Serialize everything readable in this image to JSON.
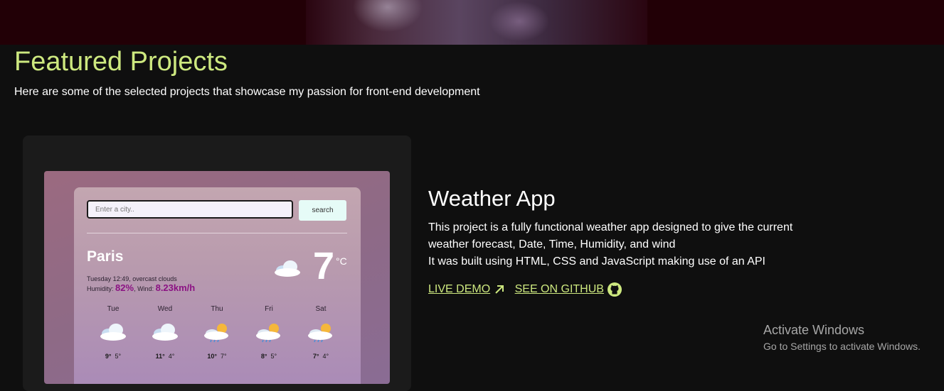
{
  "section": {
    "title": "Featured Projects",
    "subtitle": "Here are some of the selected projects that showcase my passion for front-end development"
  },
  "project": {
    "title": "Weather App",
    "description": [
      "This project is a fully functional weather app designed to give the current",
      "weather forecast, Date, Time, Humidity, and wind",
      "It was built using HTML, CSS and JavaScript making use of an API"
    ],
    "live_demo_label": "LIVE DEMO",
    "github_label": "SEE ON GITHUB",
    "live_demo_icon": "arrow-up-right-icon",
    "github_icon": "github-icon"
  },
  "preview": {
    "search_placeholder": "Enter a city..",
    "search_button": "search",
    "city": "Paris",
    "date_line": "Tuesday 12:49, overcast clouds",
    "humidity_label": "Humidity:",
    "humidity": "82%",
    "wind_label": ", Wind:",
    "wind": "8.23km/h",
    "temperature": "7",
    "unit": "°C",
    "current_icon": "cloud-icon",
    "forecast": [
      {
        "day": "Tue",
        "max": "9°",
        "min": "5°",
        "icon": "cloud-icon"
      },
      {
        "day": "Wed",
        "max": "11°",
        "min": "4°",
        "icon": "cloud-icon"
      },
      {
        "day": "Thu",
        "max": "10°",
        "min": "7°",
        "icon": "sun-rain-icon"
      },
      {
        "day": "Fri",
        "max": "8°",
        "min": "5°",
        "icon": "sun-rain-icon"
      },
      {
        "day": "Sat",
        "max": "7°",
        "min": "4°",
        "icon": "sun-rain-icon"
      }
    ]
  },
  "watermark": {
    "title": "Activate Windows",
    "subtitle": "Go to Settings to activate Windows."
  },
  "colors": {
    "accent": "#cde87f",
    "background": "#0f0f0f",
    "card": "#1b1b1b",
    "highlight": "#8b1283"
  }
}
